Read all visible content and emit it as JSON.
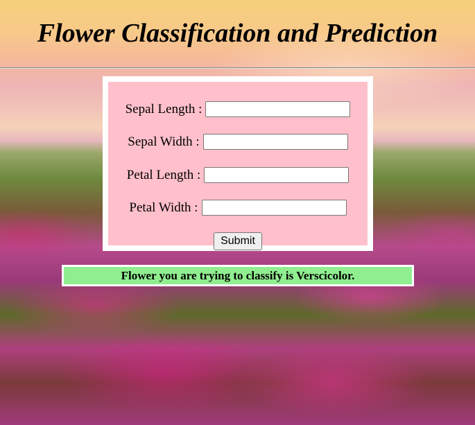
{
  "header": {
    "title": "Flower Classification and Prediction"
  },
  "form": {
    "fields": [
      {
        "label": "Sepal Length :",
        "value": "",
        "placeholder": ""
      },
      {
        "label": "Sepal Width :",
        "value": "",
        "placeholder": ""
      },
      {
        "label": "Petal Length :",
        "value": "",
        "placeholder": ""
      },
      {
        "label": "Petal Width :",
        "value": "",
        "placeholder": ""
      }
    ],
    "submit_label": "Submit"
  },
  "result": {
    "text": "Flower you are trying to classify is Verscicolor."
  },
  "colors": {
    "form_background": "#ffc0cb",
    "result_background": "#90ee90",
    "form_border": "#ffffff"
  }
}
